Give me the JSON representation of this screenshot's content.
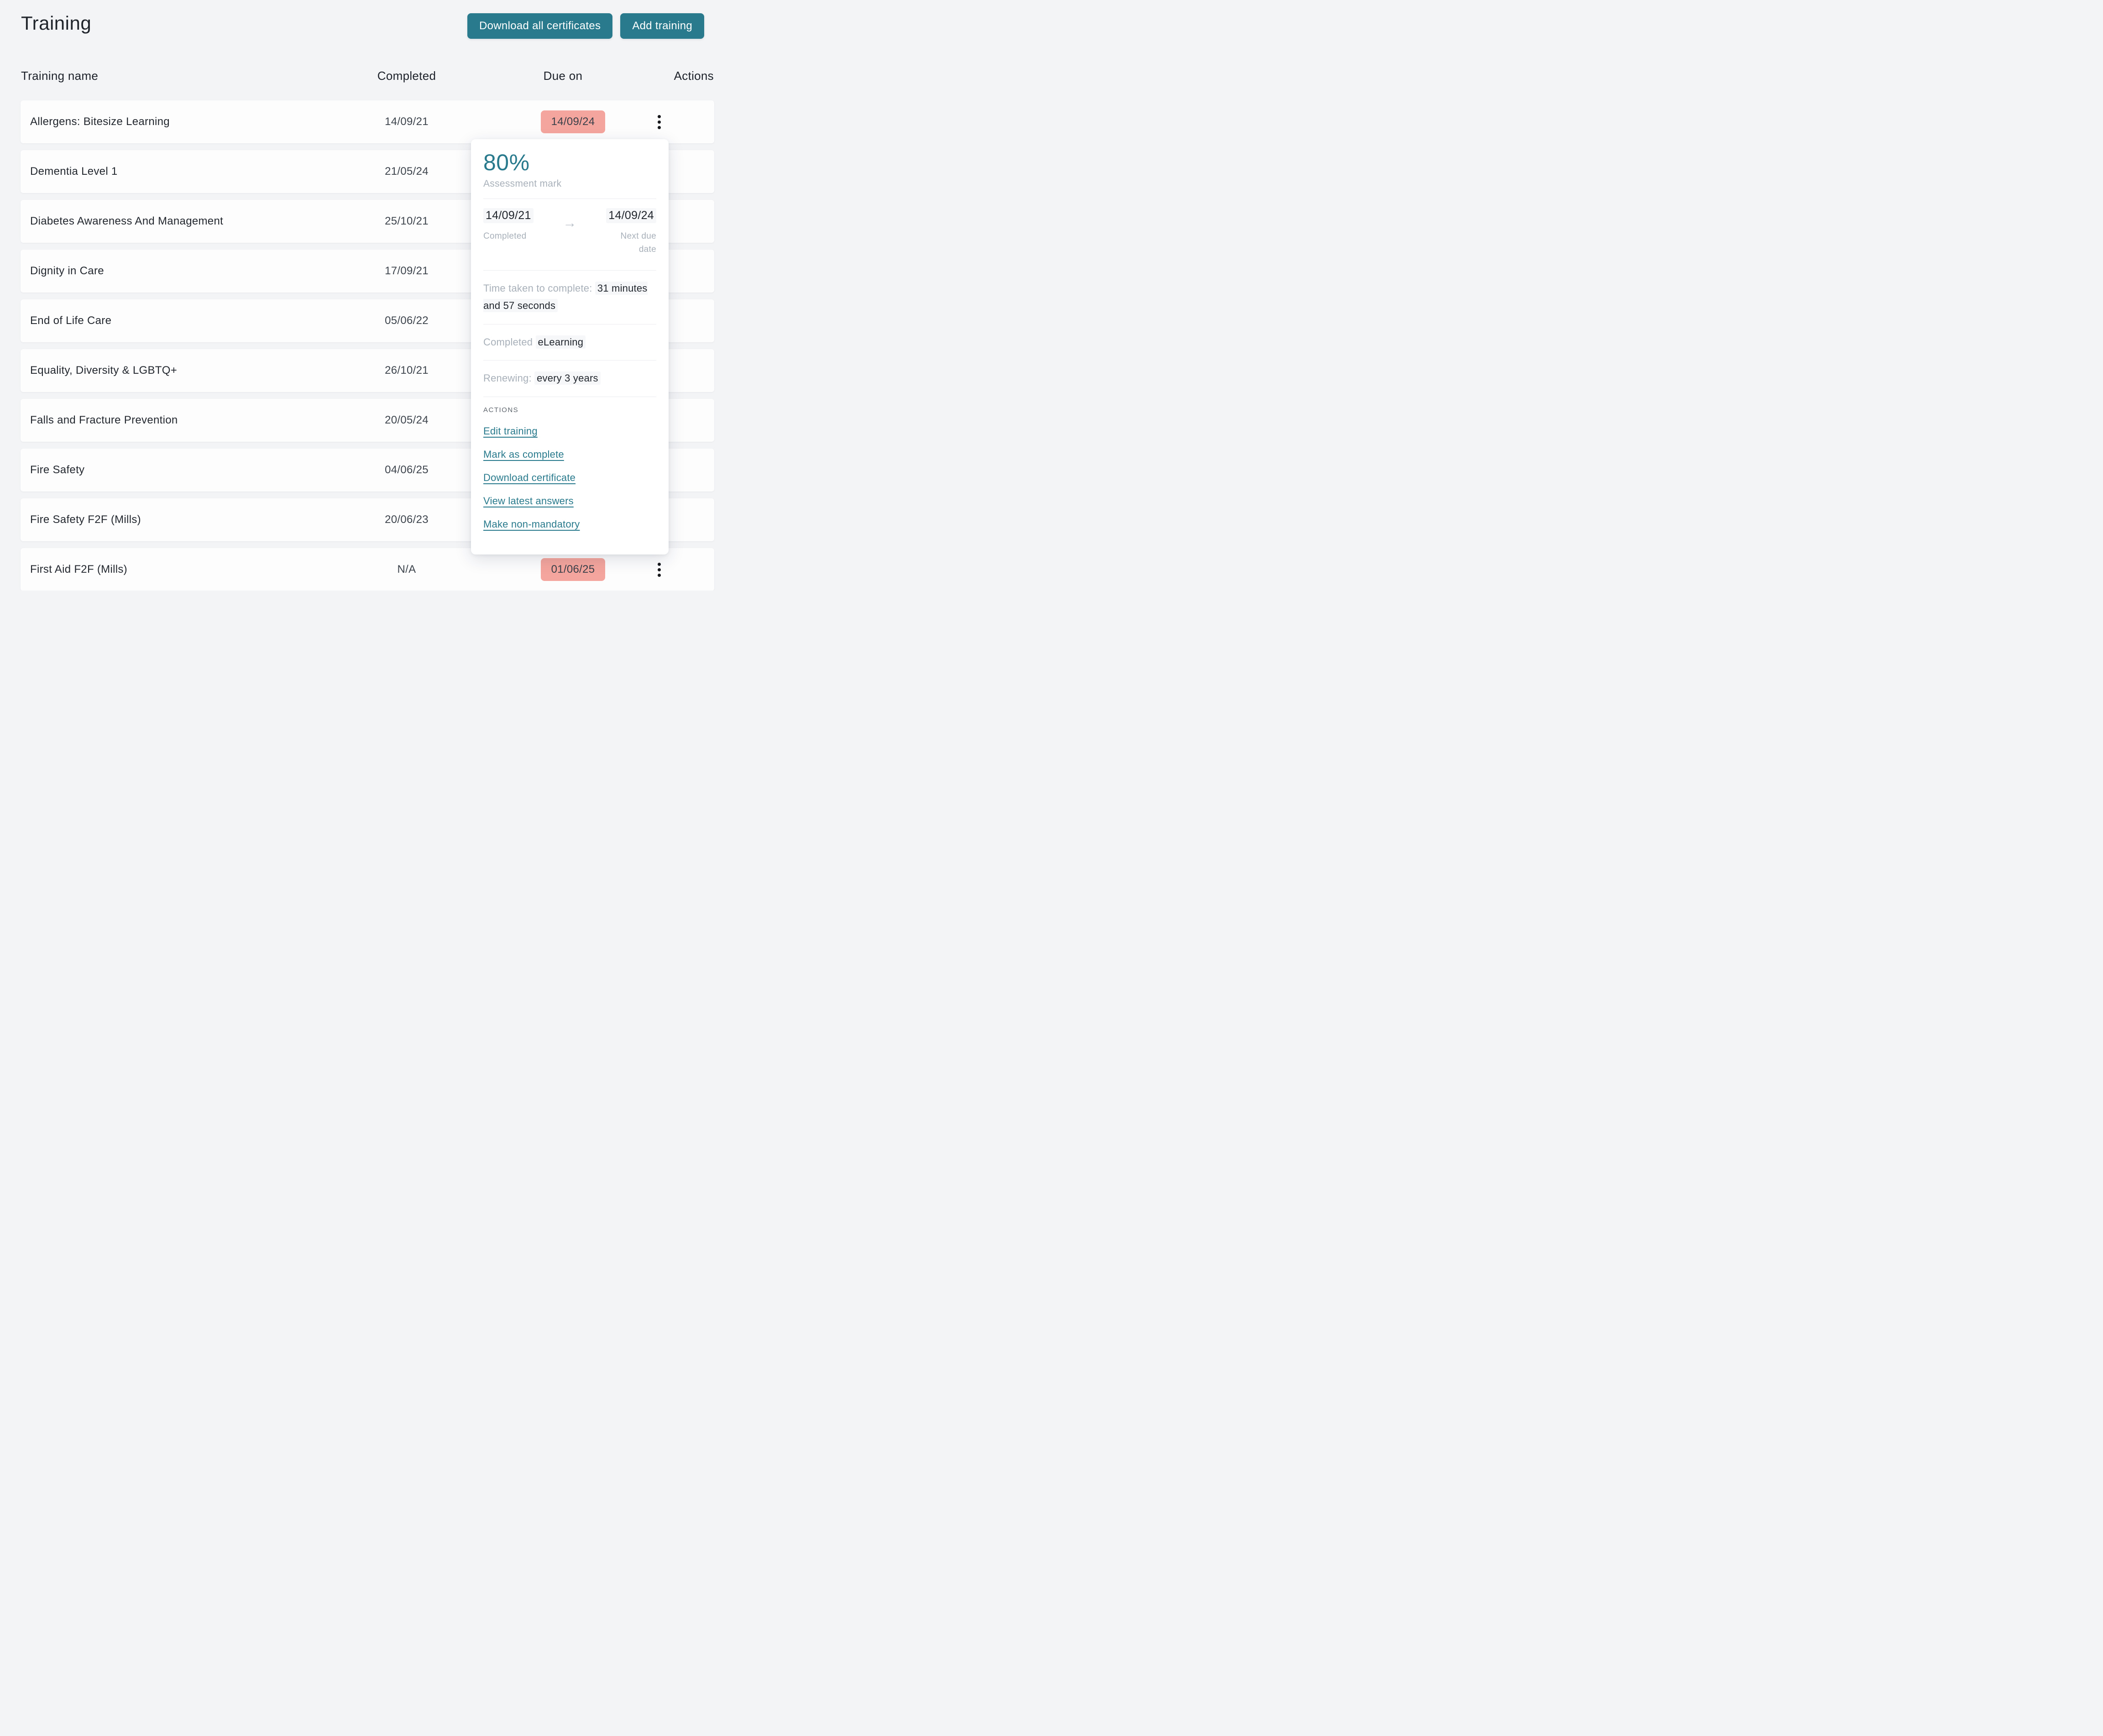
{
  "page": {
    "title": "Training"
  },
  "toolbar": {
    "download_all_label": "Download all certificates",
    "add_training_label": "Add training"
  },
  "table": {
    "headers": {
      "name": "Training name",
      "completed": "Completed",
      "due": "Due on",
      "actions": "Actions"
    },
    "rows": [
      {
        "name": "Allergens: Bitesize Learning",
        "completed": "14/09/21",
        "due": "14/09/24"
      },
      {
        "name": "Dementia Level 1",
        "completed": "21/05/24",
        "due": ""
      },
      {
        "name": "Diabetes Awareness And Management",
        "completed": "25/10/21",
        "due": ""
      },
      {
        "name": "Dignity in Care",
        "completed": "17/09/21",
        "due": ""
      },
      {
        "name": "End of Life Care",
        "completed": "05/06/22",
        "due": ""
      },
      {
        "name": "Equality, Diversity & LGBTQ+",
        "completed": "26/10/21",
        "due": ""
      },
      {
        "name": "Falls and Fracture Prevention",
        "completed": "20/05/24",
        "due": ""
      },
      {
        "name": "Fire Safety",
        "completed": "04/06/25",
        "due": ""
      },
      {
        "name": "Fire Safety F2F (Mills)",
        "completed": "20/06/23",
        "due": ""
      },
      {
        "name": "First Aid F2F (Mills)",
        "completed": "N/A",
        "due": "01/06/25"
      }
    ]
  },
  "popover": {
    "assessment_mark_value": "80%",
    "assessment_mark_label": "Assessment mark",
    "completed_date": "14/09/21",
    "completed_label": "Completed",
    "arrow": "→",
    "next_due_date": "14/09/24",
    "next_due_label_line1": "Next due",
    "next_due_label_line2": "date",
    "time_label": "Time taken to complete:",
    "time_value": "31 minutes and 57 seconds",
    "completed_method_label": "Completed",
    "completed_method_value": "eLearning",
    "renewing_label": "Renewing:",
    "renewing_value": "every 3 years",
    "actions_heading": "ACTIONS",
    "actions": [
      "Edit training",
      "Mark as complete",
      "Download certificate",
      "View latest answers",
      "Make non-mandatory"
    ]
  },
  "colors": {
    "accent_teal": "#287a8c",
    "badge_pink": "#f4a59d",
    "page_background": "#f3f4f6"
  }
}
